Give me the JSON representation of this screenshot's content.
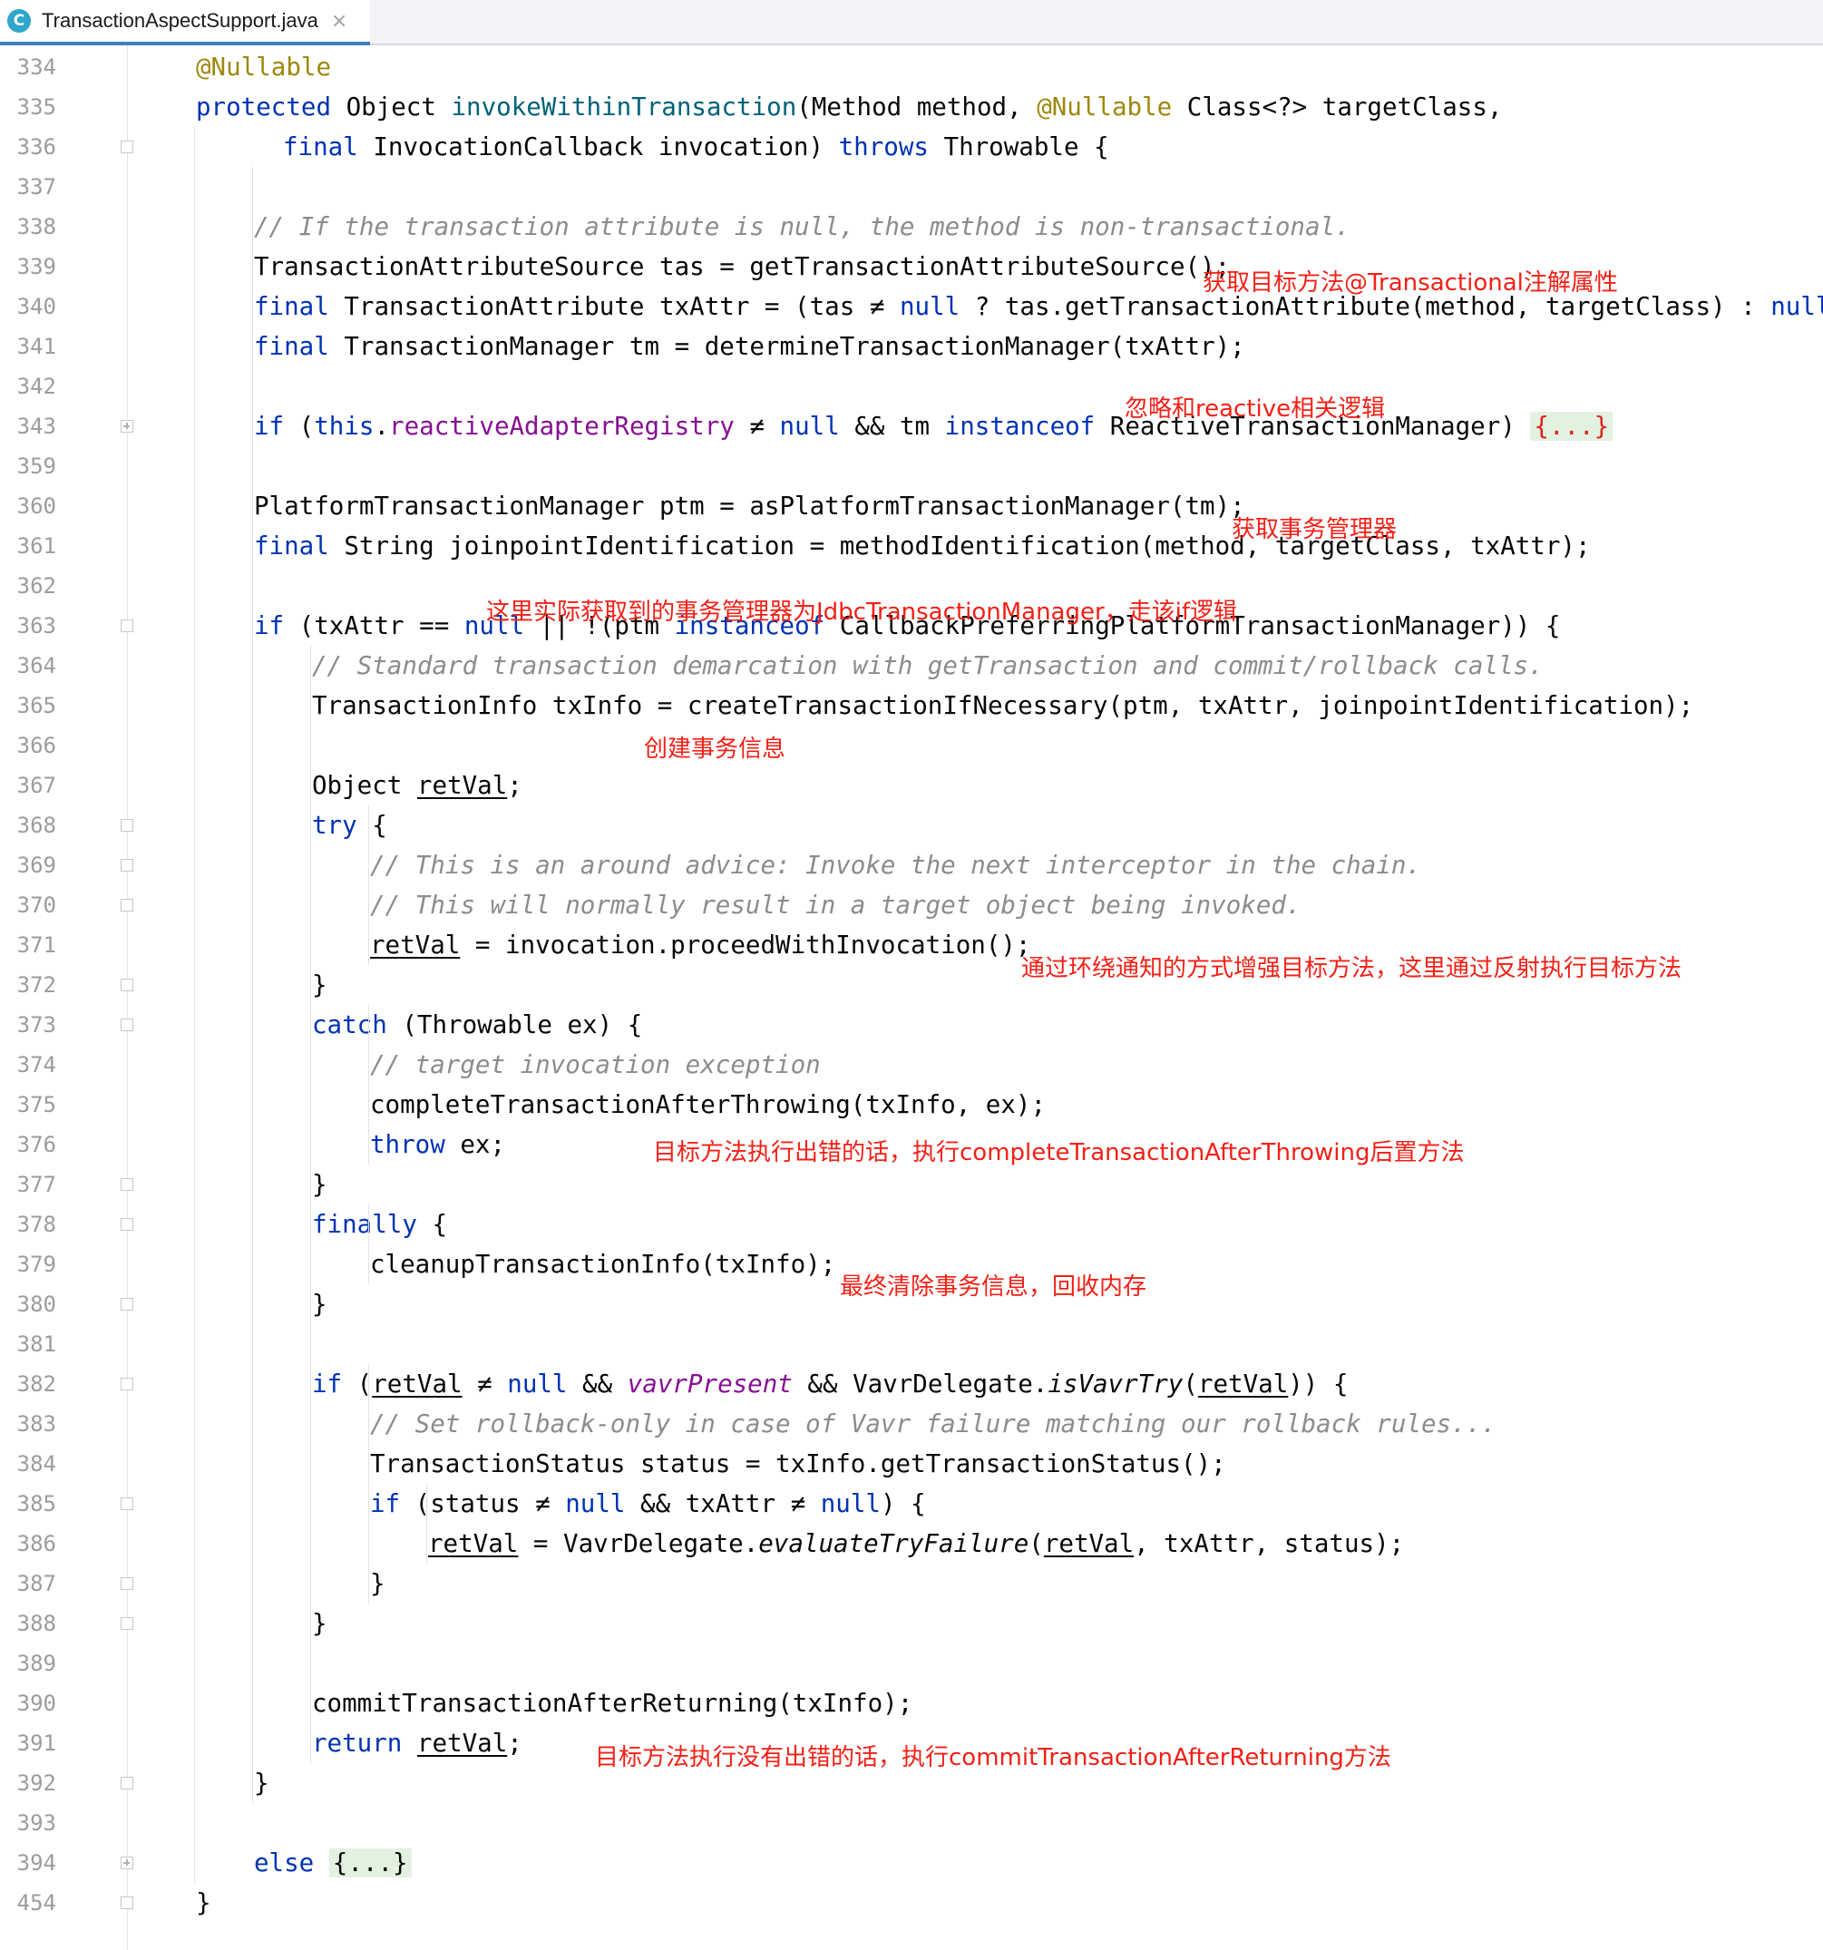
{
  "tab": {
    "title": "TransactionAspectSupport.java",
    "icon_letter": "C",
    "close_glyph": "×"
  },
  "icons": {
    "tab": "java-class-icon",
    "close": "close-icon"
  },
  "colors": {
    "keyword": "#0033b3",
    "annotation": "#9e880d",
    "method": "#00627a",
    "field": "#871094",
    "comment": "#8c8c8c",
    "note": "#f22016"
  },
  "line_numbers": [
    "334",
    "335",
    "336",
    "337",
    "338",
    "339",
    "340",
    "341",
    "342",
    "343",
    "359",
    "360",
    "361",
    "362",
    "363",
    "364",
    "365",
    "366",
    "367",
    "368",
    "369",
    "370",
    "371",
    "372",
    "373",
    "374",
    "375",
    "376",
    "377",
    "378",
    "379",
    "380",
    "381",
    "382",
    "383",
    "384",
    "385",
    "386",
    "387",
    "388",
    "389",
    "390",
    "391",
    "392",
    "393",
    "394",
    "454"
  ],
  "code": {
    "l334": "@Nullable",
    "l335": [
      {
        "t": "protected",
        "c": "kw"
      },
      {
        "t": " Object "
      },
      {
        "t": "invokeWithinTransaction",
        "c": "fn"
      },
      {
        "t": "(Method method, "
      },
      {
        "t": "@Nullable",
        "c": "ann"
      },
      {
        "t": " Class<?> targetClass,"
      }
    ],
    "l336": [
      {
        "t": "final",
        "c": "kw"
      },
      {
        "t": " InvocationCallback invocation) "
      },
      {
        "t": "throws",
        "c": "kw"
      },
      {
        "t": " Throwable {"
      }
    ],
    "l338": "// If the transaction attribute is null, the method is non-transactional.",
    "l339": "TransactionAttributeSource tas = getTransactionAttributeSource();",
    "l340": [
      {
        "t": "final",
        "c": "kw"
      },
      {
        "t": " TransactionAttribute txAttr = (tas ≠ "
      },
      {
        "t": "null",
        "c": "kw"
      },
      {
        "t": " ? tas.getTransactionAttribute(method, targetClass) : "
      },
      {
        "t": "null",
        "c": "kw"
      },
      {
        "t": ");"
      }
    ],
    "l341": [
      {
        "t": "final",
        "c": "kw"
      },
      {
        "t": " TransactionManager tm = determineTransactionManager(txAttr);"
      }
    ],
    "l343": [
      {
        "t": "if",
        "c": "kw"
      },
      {
        "t": " ("
      },
      {
        "t": "this",
        "c": "kw"
      },
      {
        "t": "."
      },
      {
        "t": "reactiveAdapterRegistry",
        "c": "fld"
      },
      {
        "t": " ≠ "
      },
      {
        "t": "null",
        "c": "kw"
      },
      {
        "t": " && tm "
      },
      {
        "t": "instanceof",
        "c": "kw"
      },
      {
        "t": " ReactiveTransactionManager) "
      },
      {
        "t": "{...}",
        "c": "fold-ph red"
      }
    ],
    "l360": "PlatformTransactionManager ptm = asPlatformTransactionManager(tm);",
    "l361": [
      {
        "t": "final",
        "c": "kw"
      },
      {
        "t": " String joinpointIdentification = methodIdentification(method, targetClass, txAttr);"
      }
    ],
    "l363": [
      {
        "t": "if",
        "c": "kw"
      },
      {
        "t": " (txAttr == "
      },
      {
        "t": "null",
        "c": "kw"
      },
      {
        "t": " || !(ptm "
      },
      {
        "t": "instanceof",
        "c": "kw"
      },
      {
        "t": " CallbackPreferringPlatformTransactionManager)) {"
      }
    ],
    "l364": "// Standard transaction demarcation with getTransaction and commit/rollback calls.",
    "l365": "TransactionInfo txInfo = createTransactionIfNecessary(ptm, txAttr, joinpointIdentification);",
    "l367": [
      {
        "t": "Object "
      },
      {
        "t": "retVal",
        "c": "ul"
      },
      {
        "t": ";"
      }
    ],
    "l368": [
      {
        "t": "try",
        "c": "kw"
      },
      {
        "t": " {"
      }
    ],
    "l369": "// This is an around advice: Invoke the next interceptor in the chain.",
    "l370": "// This will normally result in a target object being invoked.",
    "l371": [
      {
        "t": "retVal",
        "c": "ul"
      },
      {
        "t": " = invocation.proceedWithInvocation();"
      }
    ],
    "l372": "}",
    "l373": [
      {
        "t": "catch",
        "c": "kw"
      },
      {
        "t": " (Throwable ex) {"
      }
    ],
    "l374": "// target invocation exception",
    "l375": "completeTransactionAfterThrowing(txInfo, ex);",
    "l376": [
      {
        "t": "throw",
        "c": "kw"
      },
      {
        "t": " ex;"
      }
    ],
    "l377": "}",
    "l378": [
      {
        "t": "finally",
        "c": "kw"
      },
      {
        "t": " {"
      }
    ],
    "l379": "cleanupTransactionInfo(txInfo);",
    "l380": "}",
    "l382": [
      {
        "t": "if",
        "c": "kw"
      },
      {
        "t": " ("
      },
      {
        "t": "retVal",
        "c": "ul"
      },
      {
        "t": " ≠ "
      },
      {
        "t": "null",
        "c": "kw"
      },
      {
        "t": " && "
      },
      {
        "t": "vavrPresent",
        "c": "fld it"
      },
      {
        "t": " && VavrDelegate."
      },
      {
        "t": "isVavrTry",
        "c": "it"
      },
      {
        "t": "("
      },
      {
        "t": "retVal",
        "c": "ul"
      },
      {
        "t": ")) {"
      }
    ],
    "l383": "// Set rollback-only in case of Vavr failure matching our rollback rules...",
    "l384": "TransactionStatus status = txInfo.getTransactionStatus();",
    "l385": [
      {
        "t": "if",
        "c": "kw"
      },
      {
        "t": " (status ≠ "
      },
      {
        "t": "null",
        "c": "kw"
      },
      {
        "t": " && txAttr ≠ "
      },
      {
        "t": "null",
        "c": "kw"
      },
      {
        "t": ") {"
      }
    ],
    "l386": [
      {
        "t": "retVal",
        "c": "ul"
      },
      {
        "t": " = VavrDelegate."
      },
      {
        "t": "evaluateTryFailure",
        "c": "it"
      },
      {
        "t": "("
      },
      {
        "t": "retVal",
        "c": "ul"
      },
      {
        "t": ", txAttr, status);"
      }
    ],
    "l387": "}",
    "l388": "}",
    "l390": "commitTransactionAfterReturning(txInfo);",
    "l391": [
      {
        "t": "return",
        "c": "kw"
      },
      {
        "t": " "
      },
      {
        "t": "retVal",
        "c": "ul"
      },
      {
        "t": ";"
      }
    ],
    "l392": "}",
    "l394": [
      {
        "t": "else",
        "c": "kw"
      },
      {
        "t": " "
      },
      {
        "t": "{...}",
        "c": "fold-ph"
      }
    ],
    "l454": "}"
  },
  "notes": {
    "n339": "获取目标方法@Transactional注解属性",
    "n342": "忽略和reactive相关逻辑",
    "n360": "获取事务管理器",
    "n362": "这里实际获取到的事务管理器为JdbcTransactionManager，走该if逻辑",
    "n366": "创建事务信息",
    "n371": "通过环绕通知的方式增强目标方法，这里通过反射执行目标方法",
    "n376": "目标方法执行出错的话，执行completeTransactionAfterThrowing后置方法",
    "n379": "最终清除事务信息，回收内存",
    "n391": "目标方法执行没有出错的话，执行commitTransactionAfterReturning方法"
  }
}
